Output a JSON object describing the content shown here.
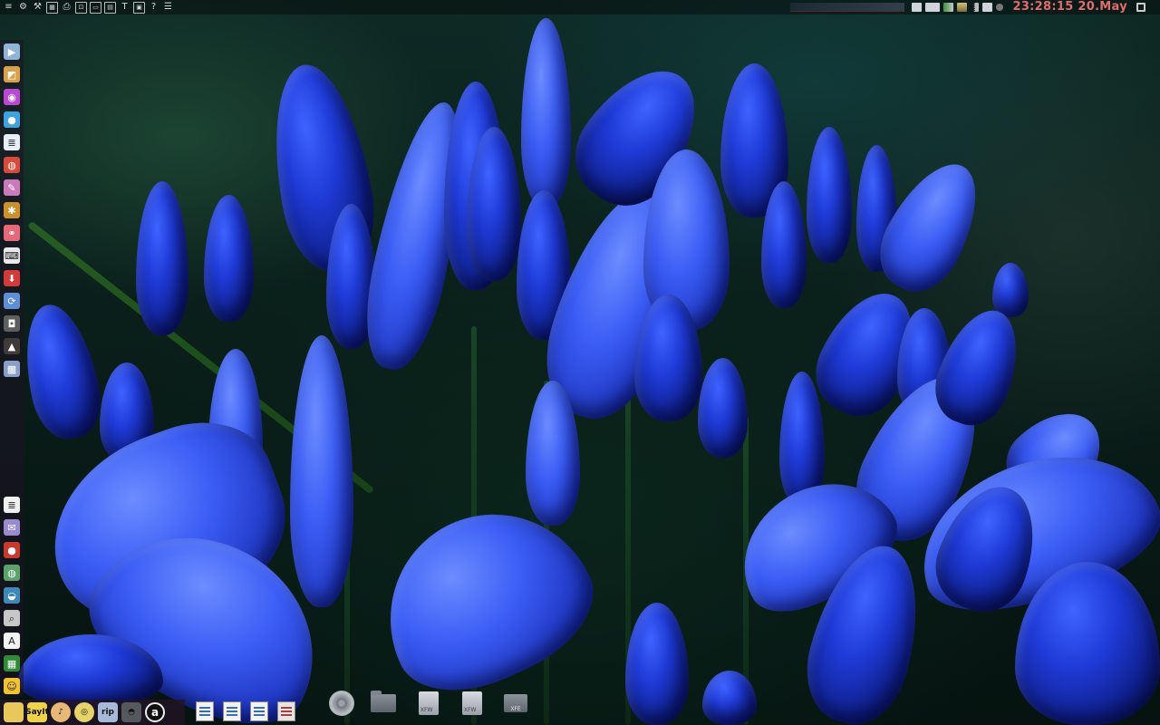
{
  "top_panel": {
    "clock_text": "23:28:15 20.May",
    "clock_color": "#e26b6b",
    "left_icons": [
      {
        "name": "menu-icon",
        "glyph": "≡"
      },
      {
        "name": "settings-gear-icon",
        "glyph": "⚙"
      },
      {
        "name": "tools-icon",
        "glyph": "⚒"
      },
      {
        "name": "calculator-icon",
        "glyph": "▦"
      },
      {
        "name": "printer-icon",
        "glyph": "⎙"
      },
      {
        "name": "window-icon",
        "glyph": "⊡"
      },
      {
        "name": "terminal-icon",
        "glyph": "▭"
      },
      {
        "name": "file-manager-icon",
        "glyph": "▤"
      },
      {
        "name": "text-editor-icon",
        "glyph": "T"
      },
      {
        "name": "picture-icon",
        "glyph": "▣"
      },
      {
        "name": "help-icon",
        "glyph": "?"
      },
      {
        "name": "list-icon",
        "glyph": "☰"
      }
    ]
  },
  "left_bar": {
    "top_icons": [
      {
        "name": "media-player-icon",
        "glyph": "▶",
        "color": "#8fb4d8"
      },
      {
        "name": "photo-viewer-icon",
        "glyph": "◩",
        "color": "#d9a24a"
      },
      {
        "name": "eye-icon",
        "glyph": "◉",
        "color": "#b64ad0"
      },
      {
        "name": "browser-icon",
        "glyph": "●",
        "color": "#3da3e0"
      },
      {
        "name": "document-icon",
        "glyph": "≣",
        "color": "#e8eef8"
      },
      {
        "name": "globe-red-icon",
        "glyph": "◍",
        "color": "#d84a3a"
      },
      {
        "name": "paint-icon",
        "glyph": "✎",
        "color": "#c97ab8"
      },
      {
        "name": "dog-icon",
        "glyph": "✱",
        "color": "#c9922e"
      },
      {
        "name": "network-icon",
        "glyph": "⚭",
        "color": "#e46a7a"
      },
      {
        "name": "keyboard-layout-icon",
        "glyph": "⌨",
        "color": "#e9e9e9"
      },
      {
        "name": "download-icon",
        "glyph": "⬇",
        "color": "#d33a3a"
      },
      {
        "name": "refresh-icon",
        "glyph": "⟳",
        "color": "#5c8fd6"
      },
      {
        "name": "camera-icon",
        "glyph": "◘",
        "color": "#5e5e5e"
      },
      {
        "name": "hat-icon",
        "glyph": "▲",
        "color": "#403a3a"
      },
      {
        "name": "package-icon",
        "glyph": "▩",
        "color": "#8a9ec8"
      }
    ],
    "bottom_icons": [
      {
        "name": "notes-icon",
        "glyph": "≣",
        "color": "#f0f0f0"
      },
      {
        "name": "chat-icon",
        "glyph": "✉",
        "color": "#9a8ad0"
      },
      {
        "name": "red-ball-icon",
        "glyph": "●",
        "color": "#c73b2e"
      },
      {
        "name": "earth-icon",
        "glyph": "◍",
        "color": "#5ba36a"
      },
      {
        "name": "globe-pencil-icon",
        "glyph": "◒",
        "color": "#3d8ab8"
      },
      {
        "name": "search-icon",
        "glyph": "⌕",
        "color": "#c7c7c7"
      },
      {
        "name": "dictionary-icon",
        "glyph": "A",
        "color": "#f3f3f3"
      },
      {
        "name": "spreadsheet-icon",
        "glyph": "▦",
        "color": "#2f8a3a"
      },
      {
        "name": "smiley-icon",
        "glyph": "☺",
        "color": "#f2c230"
      }
    ]
  },
  "bottom_bar": {
    "icons": [
      {
        "name": "start-menu-icon",
        "label": "",
        "color": "#e8c85a"
      },
      {
        "name": "sayit-icon",
        "label": "SayIt",
        "color": "#f0d24a"
      },
      {
        "name": "cd-player-icon",
        "label": "♪",
        "color": "#e8b878"
      },
      {
        "name": "cd-burner-icon",
        "label": "◎",
        "color": "#e6d46a"
      },
      {
        "name": "cd-rip-icon",
        "label": "rip",
        "color": "#a8b8d8"
      },
      {
        "name": "screenshot-icon",
        "label": "◓",
        "color": "#55595e"
      },
      {
        "name": "amazon-icon",
        "label": "a",
        "color": "#f2f2f2"
      }
    ]
  },
  "desktop_dock": {
    "items": [
      {
        "name": "optical-drive-icon",
        "kind": "disc",
        "label": ""
      },
      {
        "name": "home-folder-icon",
        "kind": "folder",
        "label": ""
      },
      {
        "name": "xfw-editor-icon",
        "kind": "paper",
        "label": "XFW"
      },
      {
        "name": "xfw-editor-2-icon",
        "kind": "paper",
        "label": "XFW"
      },
      {
        "name": "xfe-file-manager-icon",
        "kind": "xfe",
        "label": "XFE"
      }
    ]
  }
}
